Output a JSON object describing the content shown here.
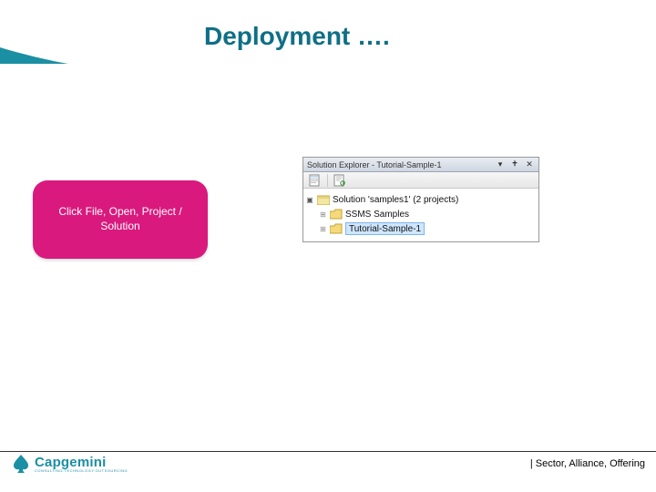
{
  "title": "Deployment ….",
  "callout": {
    "text": "Click File, Open, Project /\nSolution"
  },
  "explorer": {
    "title": "Solution Explorer - Tutorial-Sample-1",
    "toolbar": {
      "item1": "properties",
      "item2": "refresh"
    },
    "root_label": "Solution 'samples1' (2 projects)",
    "nodes": [
      {
        "label": "SSMS Samples"
      },
      {
        "label": "Tutorial-Sample-1",
        "selected": true
      }
    ]
  },
  "footer": {
    "right": "| Sector, Alliance, Offering"
  },
  "logo": {
    "name": "Capgemini",
    "tagline": "CONSULTING.TECHNOLOGY.OUTSOURCING"
  }
}
